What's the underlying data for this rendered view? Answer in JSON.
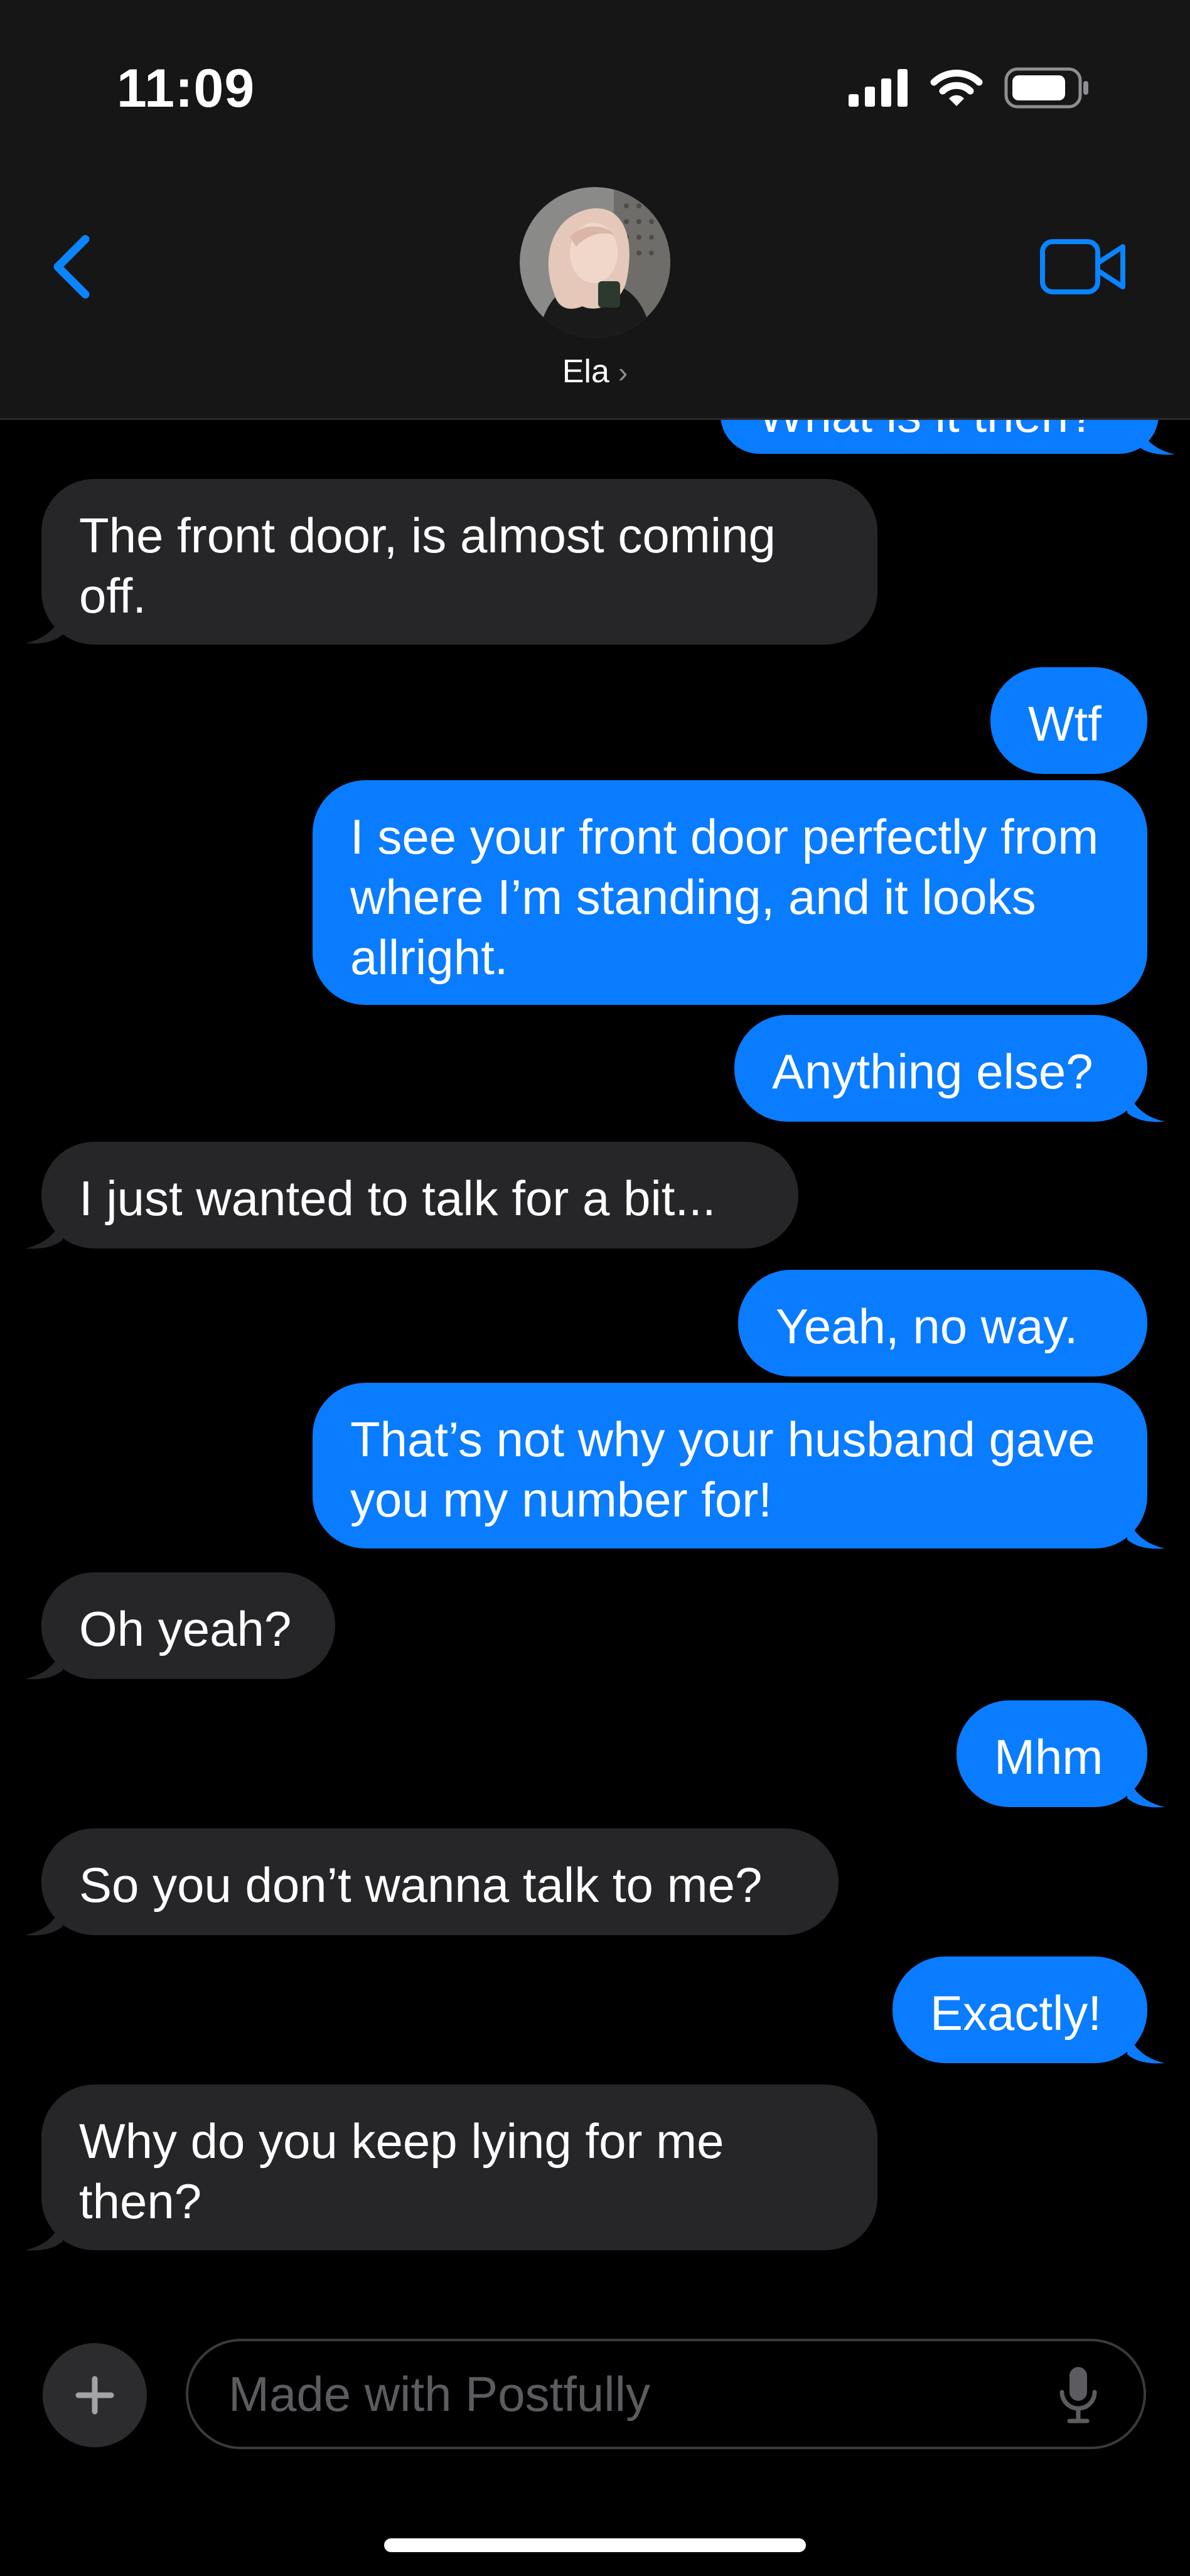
{
  "status_bar": {
    "time": "11:09",
    "icons": [
      "signal-icon",
      "wifi-icon",
      "battery-icon"
    ]
  },
  "header": {
    "back_icon": "chevron-left-icon",
    "contact_name": "Ela",
    "contact_chevron": "›",
    "video_icon": "video-camera-icon"
  },
  "colors": {
    "background": "#000000",
    "header_bg": "#161616",
    "incoming_bubble": "#262628",
    "outgoing_bubble": "#0a7cff",
    "accent": "#0a84ff"
  },
  "messages": [
    {
      "direction": "out",
      "text": "What is it then?"
    },
    {
      "direction": "in",
      "text": "The front door, is almost coming off."
    },
    {
      "direction": "out",
      "text": "Wtf"
    },
    {
      "direction": "out",
      "text": "I see your front door perfectly from where I’m standing, and it looks allright."
    },
    {
      "direction": "out",
      "text": "Anything else?"
    },
    {
      "direction": "in",
      "text": "I just wanted to talk for a bit..."
    },
    {
      "direction": "out",
      "text": "Yeah, no way."
    },
    {
      "direction": "out",
      "text": "That’s not why your husband gave you my number for!"
    },
    {
      "direction": "in",
      "text": "Oh yeah?"
    },
    {
      "direction": "out",
      "text": "Mhm"
    },
    {
      "direction": "in",
      "text": "So you don’t wanna talk to me?"
    },
    {
      "direction": "out",
      "text": "Exactly!"
    },
    {
      "direction": "in",
      "text": "Why do you keep lying for me then?"
    }
  ],
  "composer": {
    "plus_icon": "plus-icon",
    "placeholder": "Made with Postfully",
    "mic_icon": "microphone-icon"
  }
}
